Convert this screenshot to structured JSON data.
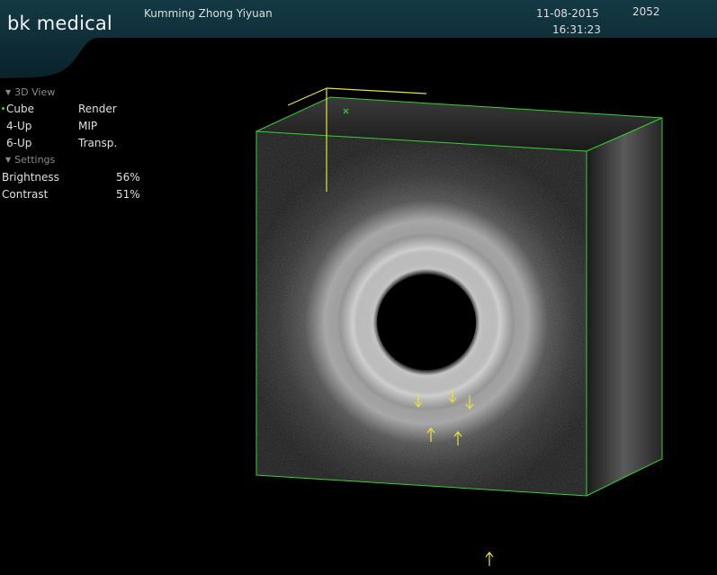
{
  "header": {
    "brand": "bk medical",
    "hospital": "Kumming Zhong Yiyuan",
    "date": "11-08-2015",
    "time": "16:31:23",
    "code": "2052"
  },
  "panel": {
    "view_section": "3D View",
    "view_rows": [
      {
        "left": "Cube",
        "right": "Render",
        "selected": true
      },
      {
        "left": "4-Up",
        "right": "MIP",
        "selected": false
      },
      {
        "left": "6-Up",
        "right": "Transp.",
        "selected": false
      }
    ],
    "settings_section": "Settings",
    "settings": [
      {
        "label": "Brightness",
        "value": "56%"
      },
      {
        "label": "Contrast",
        "value": "51%"
      }
    ]
  },
  "colors": {
    "header_bg": "#0d2a33",
    "cube_edges": "#35d135",
    "annotation": "#e8e23a",
    "selected_dot": "#3adf3a"
  },
  "icons": [
    "collapse-triangle-icon",
    "down-arrow-marker-icon",
    "up-arrow-marker-icon",
    "center-marker-icon"
  ]
}
